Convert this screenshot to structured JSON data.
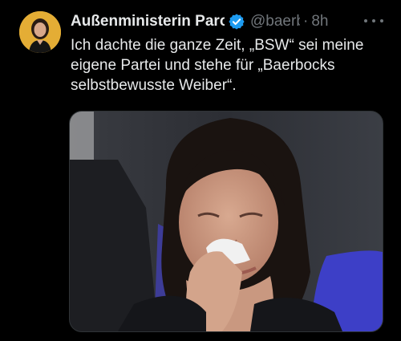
{
  "tweet": {
    "author": {
      "display_name": "Außenministerin Parody",
      "handle": "@baerbock",
      "avatar_icon": "profile-avatar",
      "verified_icon": "verified-badge-icon",
      "verified_color": "#1d9bf0"
    },
    "separator": "·",
    "time": "8h",
    "more_icon": "more-options-icon",
    "text_lines": [
      "Ich dachte die ganze Zeit, „BSW“ sei meine",
      "eigene Partei und stehe für „Baerbocks",
      "selbstbewusste Weiber“."
    ],
    "media": {
      "type": "photo"
    }
  },
  "colors": {
    "background": "#000000",
    "text_primary": "#e7e9ea",
    "text_secondary": "#71767b",
    "accent": "#1d9bf0"
  }
}
